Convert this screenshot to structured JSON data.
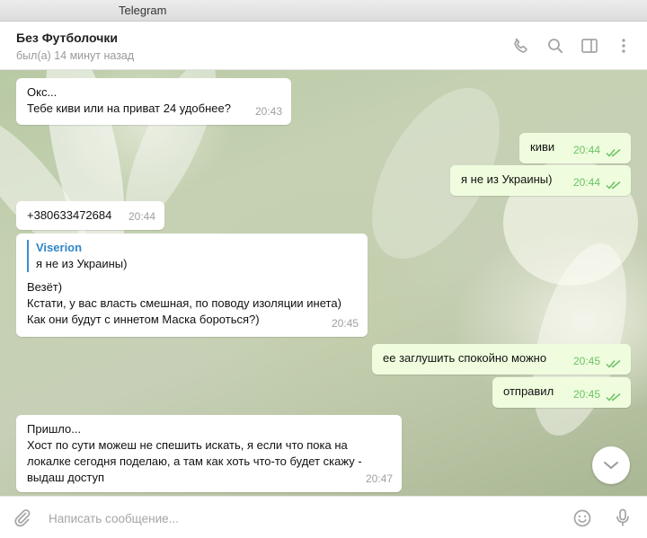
{
  "window": {
    "title": "Telegram"
  },
  "header": {
    "name": "Без Футболочки",
    "status": "был(а) 14 минут назад",
    "icons": [
      "phone-icon",
      "search-icon",
      "sidebar-icon",
      "more-icon"
    ]
  },
  "messages": [
    {
      "direction": "in",
      "lines": [
        "Окс...",
        "Тебе киви или на приват 24 удобнее?"
      ],
      "time": "20:43"
    },
    {
      "direction": "out",
      "text": "киви",
      "time": "20:44",
      "read": true
    },
    {
      "direction": "out",
      "text": "я не из Украины)",
      "time": "20:44",
      "read": true
    },
    {
      "direction": "in",
      "text": "+380633472684",
      "time": "20:44"
    },
    {
      "direction": "in",
      "reply": {
        "name": "Viserion",
        "text": "я не из Украины)"
      },
      "lines": [
        "Везёт)",
        "Кстати, у вас власть смешная, по поводу изоляции инета)",
        "Как они будут с иннетом Маска бороться?)"
      ],
      "time": "20:45"
    },
    {
      "direction": "out",
      "text": "ее заглушить спокойно можно",
      "time": "20:45",
      "read": true
    },
    {
      "direction": "out",
      "text": "отправил",
      "time": "20:45",
      "read": true
    },
    {
      "direction": "in",
      "lines": [
        "Пришло...",
        "Хост по сути можеш не спешить искать, я если что пока на",
        "локалке сегодня поделаю, а там как хоть что-то будет скажу -",
        "выдаш доступ"
      ],
      "time": "20:47"
    }
  ],
  "composer": {
    "placeholder": "Написать сообщение...",
    "value": ""
  },
  "colors": {
    "accent": "#3e8bcd",
    "outgoing_bubble": "#effdde",
    "read_check": "#6cc264"
  }
}
